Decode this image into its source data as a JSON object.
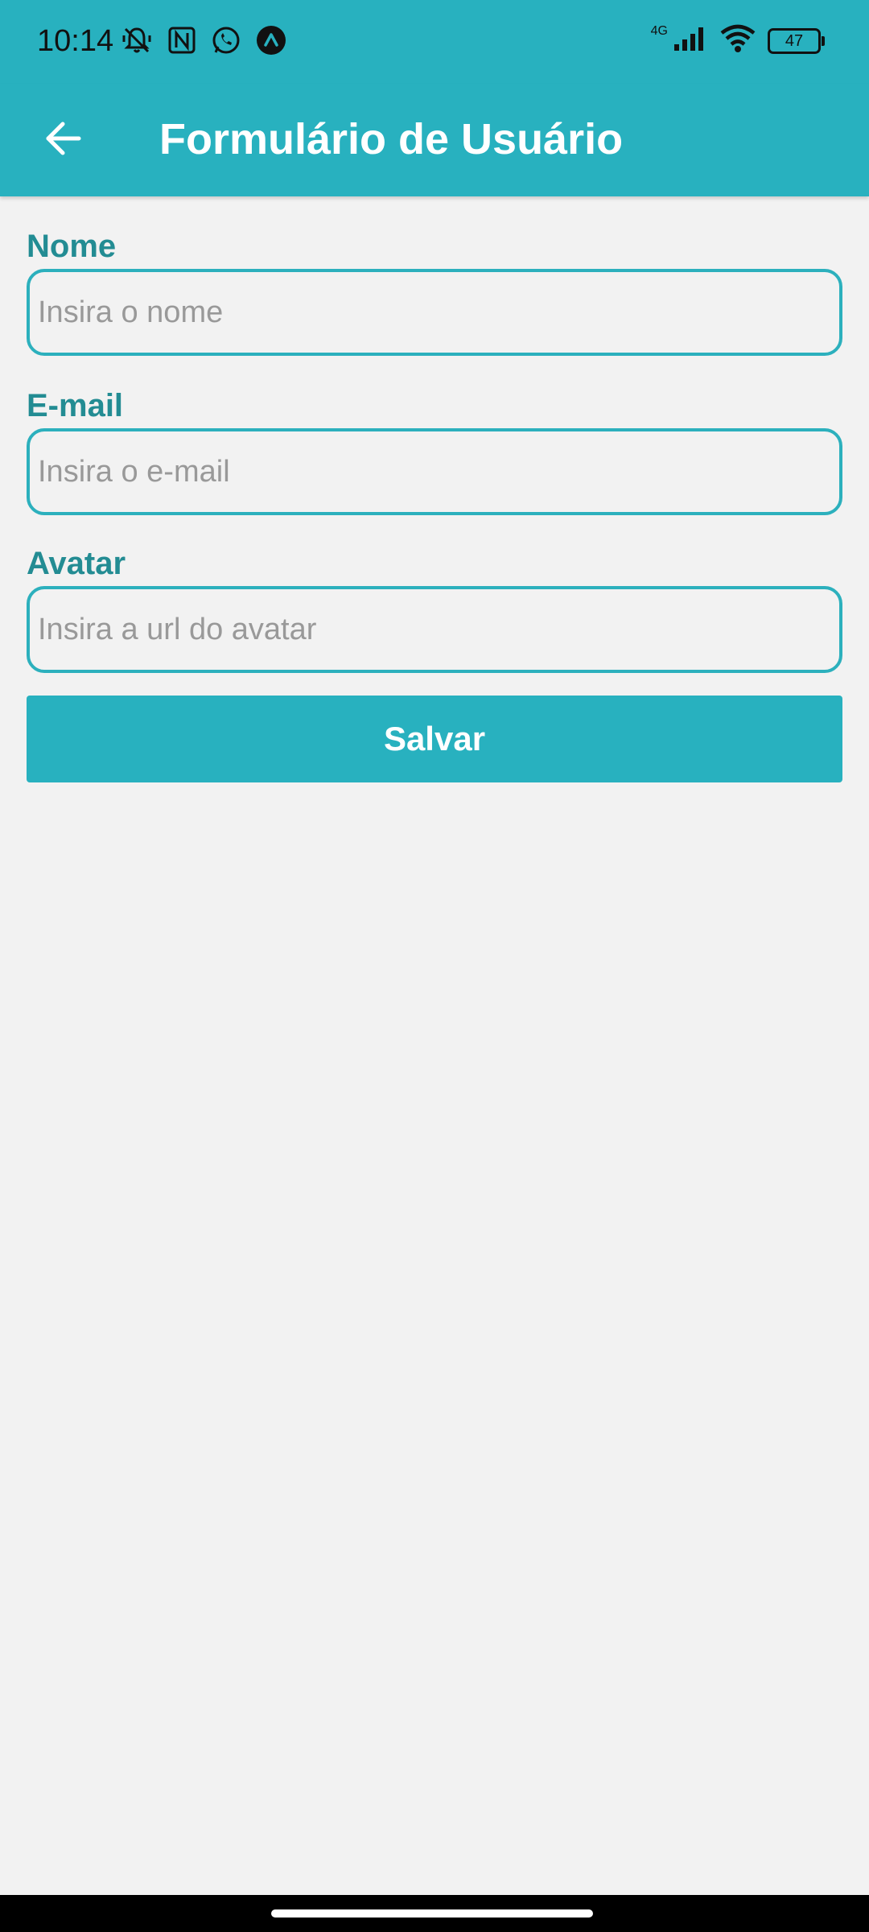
{
  "status_bar": {
    "time": "10:14",
    "network": "4G",
    "battery": "47",
    "icons_left": [
      "muted-notification-icon",
      "nfc-icon",
      "whatsapp-icon",
      "app-notification-icon"
    ],
    "icons_right": [
      "signal-icon",
      "wifi-icon",
      "battery-icon"
    ]
  },
  "app_bar": {
    "title": "Formulário de Usuário",
    "back_icon": "arrow-left-icon",
    "color": "#28b1bf"
  },
  "form": {
    "fields": [
      {
        "label": "Nome",
        "placeholder": "Insira o nome",
        "value": ""
      },
      {
        "label": "E-mail",
        "placeholder": "Insira o e-mail",
        "value": ""
      },
      {
        "label": "Avatar",
        "placeholder": "Insira a url do avatar",
        "value": ""
      }
    ],
    "submit_label": "Salvar",
    "label_color": "#238c93",
    "border_color": "#2cb0bd"
  }
}
